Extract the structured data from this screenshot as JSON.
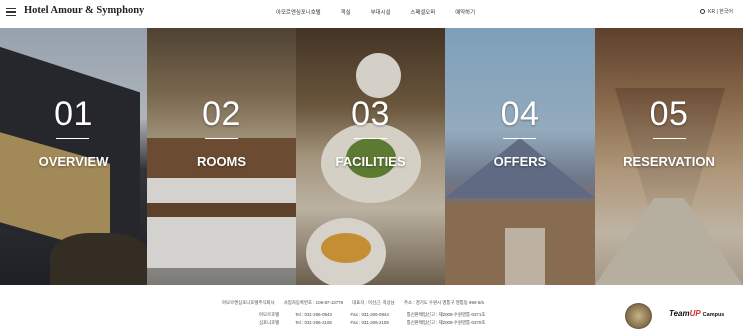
{
  "header": {
    "logo": "Hotel Amour & Symphony",
    "nav": [
      "아모르앤심포니호텔",
      "객실",
      "부대시설",
      "스페셜오퍼",
      "예약하기"
    ],
    "lang": "KR  |  한국어"
  },
  "panels": [
    {
      "num": "01",
      "label": "OVERVIEW"
    },
    {
      "num": "02",
      "label": "ROOMS"
    },
    {
      "num": "03",
      "label": "FACILITIES"
    },
    {
      "num": "04",
      "label": "OFFERS"
    },
    {
      "num": "05",
      "label": "RESERVATION"
    }
  ],
  "footer": {
    "company": "아모르앤심포니호텔주식회사",
    "bizno": "사업자등록번호 : 106-87-13779",
    "ceo": "대표자 : 이선근, 곽상남",
    "address": "주소 : 경기도 수원시 영통구 영통동 996-5/6",
    "rows": [
      {
        "name": "아모르호텔",
        "tel": "Tel : 031-206-0943",
        "fax": "Fax : 031-206-0944",
        "report": "통신판매업신고 : 제2009-수원영통-0371호"
      },
      {
        "name": "심포니호텔",
        "tel": "Tel : 031-206-2106",
        "fax": "Fax : 031-206-2108",
        "report": "통신판매업신고 : 제2009-수원영통-0370호"
      }
    ],
    "badge2": {
      "team": "Team",
      "up": "UP",
      "campus": "Campus"
    }
  }
}
